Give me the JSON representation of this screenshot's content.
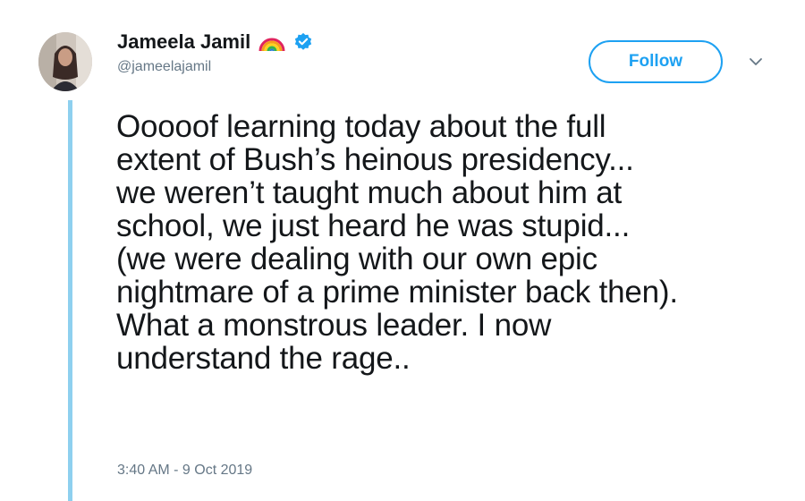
{
  "author": {
    "name": "Jameela Jamil",
    "handle": "@jameelajamil",
    "name_emoji_icon": "rainbow-icon",
    "verified_icon": "verified-badge-icon",
    "avatar_icon": "avatar"
  },
  "actions": {
    "follow_label": "Follow",
    "more_icon": "chevron-down-icon"
  },
  "tweet": {
    "text": "Ooooof learning today about the full\nextent of Bush’s heinous presidency...\nwe weren’t taught much about him at\nschool, we just heard he was stupid...\n(we were dealing with our own epic\nnightmare of a prime minister back then).\nWhat a monstrous leader. I now\nunderstand the rage..",
    "timestamp": "3:40 AM - 9 Oct 2019"
  },
  "colors": {
    "accent": "#1da1f2",
    "thread_line": "#8ed0ef",
    "secondary_text": "#657786",
    "primary_text": "#14171a"
  }
}
